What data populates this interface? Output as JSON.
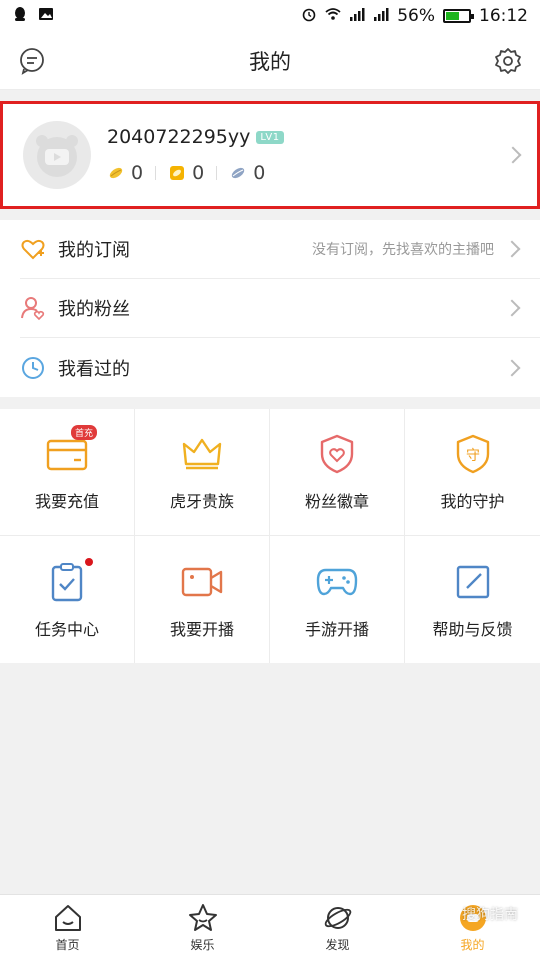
{
  "status_bar": {
    "battery": "56%",
    "time": "16:12",
    "battery_level": 0.56,
    "icons": [
      "qq-icon",
      "image-icon",
      "alarm-icon",
      "wifi-icon",
      "signal-icon",
      "signal-icon",
      "battery-icon"
    ]
  },
  "header": {
    "title": "我的",
    "left_icon": "message-icon",
    "right_icon": "gear-icon"
  },
  "profile": {
    "username": "2040722295yy",
    "level": "LV1",
    "stats": [
      {
        "icon": "gold-bean-icon",
        "value": "0"
      },
      {
        "icon": "coin-icon",
        "value": "0"
      },
      {
        "icon": "silver-bean-icon",
        "value": "0"
      }
    ]
  },
  "list": [
    {
      "icon": "heart-plus-icon",
      "label": "我的订阅",
      "hint": "没有订阅，先找喜欢的主播吧"
    },
    {
      "icon": "user-heart-icon",
      "label": "我的粉丝",
      "hint": ""
    },
    {
      "icon": "clock-icon",
      "label": "我看过的",
      "hint": ""
    }
  ],
  "grid": [
    {
      "icon": "wallet-icon",
      "label": "我要充值",
      "badge": "首充"
    },
    {
      "icon": "crown-icon",
      "label": "虎牙贵族",
      "badge": ""
    },
    {
      "icon": "shield-heart-icon",
      "label": "粉丝徽章",
      "badge": ""
    },
    {
      "icon": "shield-guard-icon",
      "label": "我的守护",
      "badge": "",
      "glyph": "守"
    },
    {
      "icon": "clipboard-check-icon",
      "label": "任务中心",
      "badge": ""
    },
    {
      "icon": "video-camera-icon",
      "label": "我要开播",
      "badge": ""
    },
    {
      "icon": "gamepad-icon",
      "label": "手游开播",
      "badge": ""
    },
    {
      "icon": "edit-icon",
      "label": "帮助与反馈",
      "badge": ""
    }
  ],
  "bottom_nav": [
    {
      "icon": "home-icon",
      "label": "首页"
    },
    {
      "icon": "star-icon",
      "label": "娱乐"
    },
    {
      "icon": "planet-icon",
      "label": "发现"
    },
    {
      "icon": "profile-icon",
      "label": "我的",
      "active": true
    }
  ],
  "colors": {
    "accent": "#f5a623",
    "highlight_border": "#e02020",
    "level_badge": "#8ed8c8"
  },
  "watermark": "搜狗指南"
}
